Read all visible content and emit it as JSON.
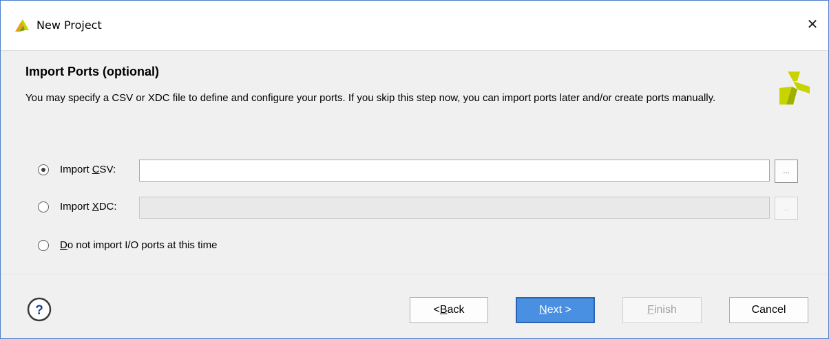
{
  "window": {
    "title": "New Project",
    "close_glyph": "✕",
    "app_icon": "vivado-logo-icon",
    "brand_icon": "vivado-logo-icon"
  },
  "page": {
    "heading": "Import Ports (optional)",
    "description": "You may specify a CSV or XDC file to define and configure your ports. If you skip this step now, you can import ports later and/or create ports manually."
  },
  "options": [
    {
      "label_pre": "Import ",
      "label_mnemonic": "C",
      "label_post": "SV:",
      "selected": true,
      "input_value": "",
      "input_enabled": true,
      "browse_label": "..."
    },
    {
      "label_pre": "Import ",
      "label_mnemonic": "X",
      "label_post": "DC:",
      "selected": false,
      "input_value": "",
      "input_enabled": false,
      "browse_label": "..."
    },
    {
      "label_pre": "",
      "label_mnemonic": "D",
      "label_post": "o not import I/O ports at this time",
      "selected": false
    }
  ],
  "footer": {
    "help_icon": "help-icon",
    "help_glyph": "?",
    "back": {
      "pre": "< ",
      "mnemonic": "B",
      "post": "ack"
    },
    "next": {
      "pre": "",
      "mnemonic": "N",
      "post": "ext >"
    },
    "finish": {
      "pre": "",
      "mnemonic": "F",
      "post": "inish"
    },
    "cancel": {
      "label": "Cancel"
    }
  },
  "colors": {
    "accent": "#4a90e2",
    "logo_yellow": "#c8d400",
    "logo_dark": "#c08a1e"
  }
}
